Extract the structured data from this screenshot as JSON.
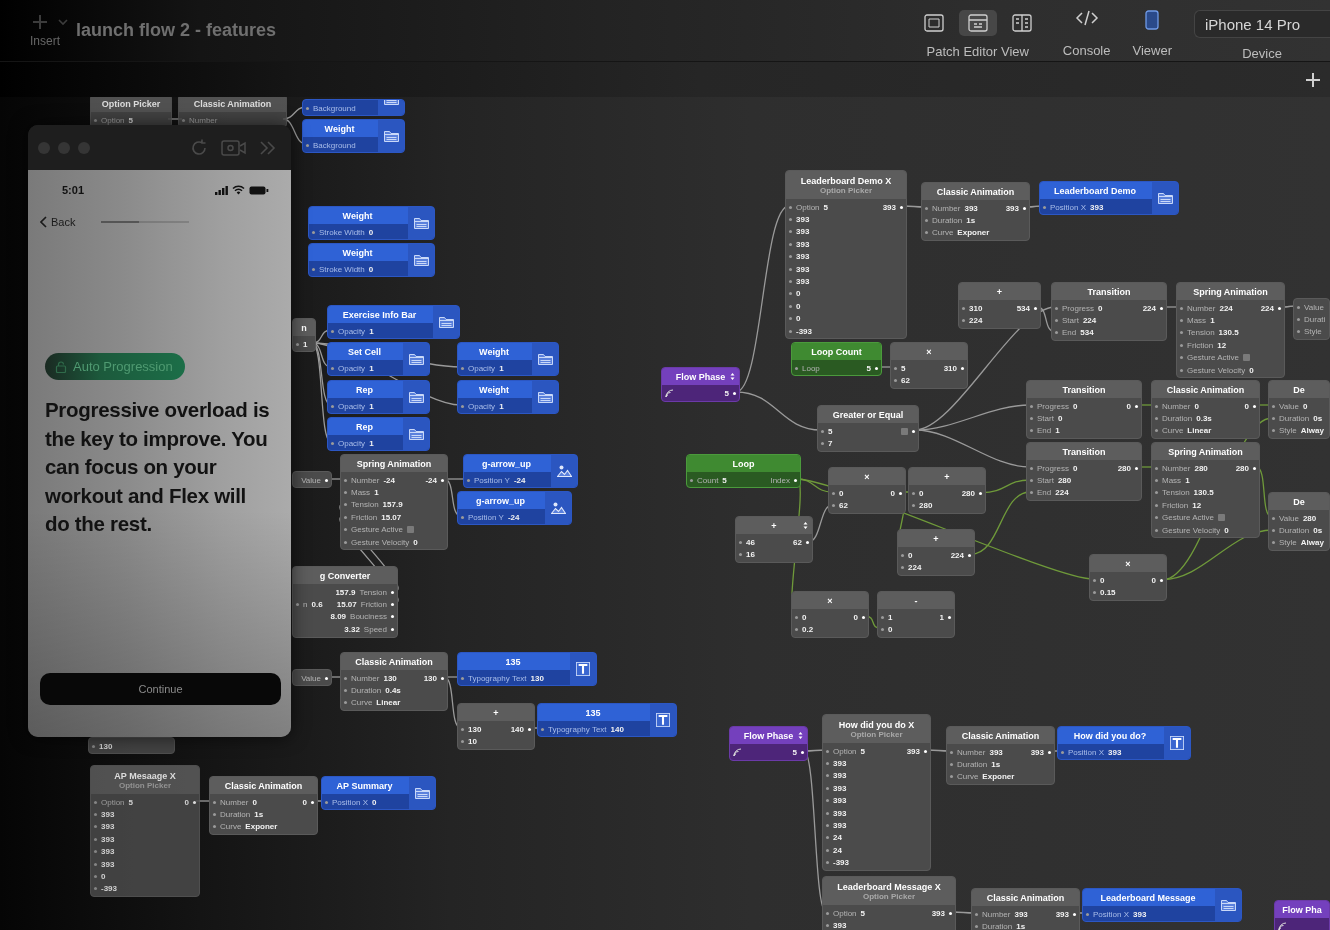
{
  "toolbar": {
    "insert_label": "Insert",
    "title": "launch flow 2 - features",
    "view_modes": [
      {
        "selected": false
      },
      {
        "selected": true
      },
      {
        "selected": false
      }
    ],
    "view_label": "Patch Editor View",
    "console_label": "Console",
    "viewer_label": "Viewer",
    "device": "iPhone 14 Pro",
    "device_label": "Device"
  },
  "preview": {
    "time": "5:01",
    "back": "Back",
    "progress": {
      "level": 0.43
    },
    "badge": "Auto Progression",
    "message": "Progressive overload is the key to improve. You can focus on your workout and Flex will do the rest.",
    "button": "Continue"
  },
  "nodes": [
    {
      "kind": "patch",
      "title": "Option Picker",
      "rows": [
        {
          "label": "Option",
          "value": "5"
        }
      ]
    },
    {
      "kind": "patch",
      "title": "Classic Animation",
      "rows": [
        {
          "label": "Number"
        }
      ]
    },
    {
      "kind": "layer_group",
      "rows": [
        {
          "label": "Background"
        }
      ]
    },
    {
      "kind": "layer_group",
      "title": "Weight",
      "rows": [
        {
          "label": "Background"
        }
      ]
    },
    {
      "kind": "layer_group",
      "title": "Weight",
      "rows": [
        {
          "label": "Stroke Width",
          "value": "0"
        }
      ]
    },
    {
      "kind": "layer_group",
      "title": "Weight",
      "rows": [
        {
          "label": "Stroke Width",
          "value": "0"
        }
      ]
    },
    {
      "kind": "patch",
      "title": "n",
      "rows": [
        {
          "value": "1"
        }
      ]
    },
    {
      "kind": "layer_group",
      "title": "Exercise Info Bar",
      "rows": [
        {
          "label": "Opacity",
          "value": "1"
        }
      ]
    },
    {
      "kind": "layer_group",
      "title": "Set Cell",
      "rows": [
        {
          "label": "Opacity",
          "value": "1"
        }
      ]
    },
    {
      "kind": "layer_group",
      "title": "Weight",
      "rows": [
        {
          "label": "Opacity",
          "value": "1"
        }
      ]
    },
    {
      "kind": "layer_group",
      "title": "Rep",
      "rows": [
        {
          "label": "Opacity",
          "value": "1"
        }
      ]
    },
    {
      "kind": "layer_group",
      "title": "Weight",
      "rows": [
        {
          "label": "Opacity",
          "value": "1"
        }
      ]
    },
    {
      "kind": "layer_group",
      "title": "Rep",
      "rows": [
        {
          "label": "Opacity",
          "value": "1"
        }
      ]
    },
    {
      "kind": "patch",
      "rows": [
        {
          "out_label": "Value"
        }
      ]
    },
    {
      "kind": "patch",
      "title": "Spring Animation",
      "rows": [
        {
          "label": "Number",
          "value": "-24",
          "out": "-24"
        },
        {
          "label": "Mass",
          "value": "1"
        },
        {
          "label": "Tension",
          "value": "157.9"
        },
        {
          "label": "Friction",
          "value": "15.07"
        },
        {
          "label": "Gesture Active",
          "checked": false
        },
        {
          "label": "Gesture Velocity",
          "value": "0"
        }
      ]
    },
    {
      "kind": "layer_image",
      "title": "g-arrow_up",
      "rows": [
        {
          "label": "Position Y",
          "value": "-24"
        }
      ]
    },
    {
      "kind": "layer_image",
      "title": "g-arrow_up",
      "rows": [
        {
          "label": "Position Y",
          "value": "-24"
        }
      ]
    },
    {
      "kind": "patch",
      "title": "g Converter",
      "rows": [
        {
          "out": "157.9",
          "out_label": "Tension"
        },
        {
          "label": "n",
          "value": "0.6",
          "out": "15.07",
          "out_label": "Friction"
        },
        {
          "out": "8.09",
          "out_label": "Bouciness"
        },
        {
          "out": "3.32",
          "out_label": "Speed"
        }
      ]
    },
    {
      "kind": "patch",
      "rows": [
        {
          "out_label": "Value"
        }
      ]
    },
    {
      "kind": "patch",
      "title": "Classic Animation",
      "rows": [
        {
          "label": "Number",
          "value": "130",
          "out": "130"
        },
        {
          "label": "Duration",
          "value": "0.4s"
        },
        {
          "label": "Curve",
          "value": "Linear"
        }
      ]
    },
    {
      "kind": "layer_text",
      "title": "135",
      "rows": [
        {
          "label": "Typography Text",
          "value": "130"
        }
      ]
    },
    {
      "kind": "patch",
      "title": "+",
      "rows": [
        {
          "value": "130",
          "out": "140"
        },
        {
          "value": "10"
        }
      ]
    },
    {
      "kind": "layer_text",
      "title": "135",
      "rows": [
        {
          "label": "Typography Text",
          "value": "140"
        }
      ]
    },
    {
      "kind": "patch",
      "rows": [
        {
          "value": "130"
        }
      ]
    },
    {
      "kind": "patch",
      "title": "AP Mesaage X",
      "subtitle": "Option Picker",
      "rows": [
        {
          "label": "Option",
          "value": "5",
          "out": "0"
        },
        {
          "value": "393"
        },
        {
          "value": "393"
        },
        {
          "value": "393"
        },
        {
          "value": "393"
        },
        {
          "value": "393"
        },
        {
          "value": "0"
        },
        {
          "value": "-393"
        }
      ]
    },
    {
      "kind": "patch",
      "title": "Classic Animation",
      "rows": [
        {
          "label": "Number",
          "value": "0",
          "out": "0"
        },
        {
          "label": "Duration",
          "value": "1s"
        },
        {
          "label": "Curve",
          "value": "Exponer"
        }
      ]
    },
    {
      "kind": "layer_group",
      "title": "AP Summary",
      "rows": [
        {
          "label": "Position X",
          "value": "0"
        }
      ]
    },
    {
      "kind": "phase",
      "title": "Flow Phase",
      "stepper": true,
      "value": "5"
    },
    {
      "kind": "patch",
      "title": "Leaderboard Demo X",
      "subtitle": "Option Picker",
      "rows": [
        {
          "label": "Option",
          "value": "5",
          "out": "393"
        },
        {
          "value": "393"
        },
        {
          "value": "393"
        },
        {
          "value": "393"
        },
        {
          "value": "393"
        },
        {
          "value": "393"
        },
        {
          "value": "393"
        },
        {
          "value": "0"
        },
        {
          "value": "0"
        },
        {
          "value": "0"
        },
        {
          "value": "-393"
        }
      ]
    },
    {
      "kind": "patch",
      "title": "Classic Animation",
      "rows": [
        {
          "label": "Number",
          "value": "393",
          "out": "393"
        },
        {
          "label": "Duration",
          "value": "1s"
        },
        {
          "label": "Curve",
          "value": "Exponer"
        }
      ]
    },
    {
      "kind": "layer_group",
      "title": "Leaderboard Demo",
      "rows": [
        {
          "label": "Position X",
          "value": "393"
        }
      ]
    },
    {
      "kind": "loop",
      "title": "Loop Count",
      "rows": [
        {
          "label": "Loop",
          "out": "5"
        }
      ]
    },
    {
      "kind": "patch",
      "title": "×",
      "rows": [
        {
          "value": "5",
          "out": "310"
        },
        {
          "value": "62"
        }
      ]
    },
    {
      "kind": "patch",
      "title": "+",
      "rows": [
        {
          "value": "310",
          "out": "534"
        },
        {
          "value": "224"
        }
      ]
    },
    {
      "kind": "patch",
      "title": "Transition",
      "rows": [
        {
          "label": "Progress",
          "value": "0",
          "out": "224"
        },
        {
          "label": "Start",
          "value": "224"
        },
        {
          "label": "End",
          "value": "534"
        }
      ]
    },
    {
      "kind": "patch",
      "title": "Spring Animation",
      "rows": [
        {
          "label": "Number",
          "value": "224",
          "out": "224"
        },
        {
          "label": "Mass",
          "value": "1"
        },
        {
          "label": "Tension",
          "value": "130.5"
        },
        {
          "label": "Friction",
          "value": "12"
        },
        {
          "label": "Gesture Active",
          "checked": false
        },
        {
          "label": "Gesture Velocity",
          "value": "0"
        }
      ]
    },
    {
      "kind": "patch",
      "rows": [
        {
          "label": "Value"
        },
        {
          "label": "Durati"
        },
        {
          "label": "Style"
        }
      ]
    },
    {
      "kind": "patch",
      "title": "Greater or Equal",
      "rows": [
        {
          "value": "5",
          "out_checked": false
        },
        {
          "value": "7"
        }
      ]
    },
    {
      "kind": "patch",
      "title": "Transition",
      "rows": [
        {
          "label": "Progress",
          "value": "0",
          "out": "0"
        },
        {
          "label": "Start",
          "value": "0"
        },
        {
          "label": "End",
          "value": "1"
        }
      ]
    },
    {
      "kind": "patch",
      "title": "Classic Animation",
      "rows": [
        {
          "label": "Number",
          "value": "0",
          "out": "0"
        },
        {
          "label": "Duration",
          "value": "0.3s"
        },
        {
          "label": "Curve",
          "value": "Linear"
        }
      ]
    },
    {
      "kind": "patch",
      "title": "De",
      "rows": [
        {
          "label": "Value",
          "value": "0"
        },
        {
          "label": "Duration",
          "value": "0s"
        },
        {
          "label": "Style",
          "value": "Alway"
        }
      ]
    },
    {
      "kind": "loop",
      "title": "Loop",
      "rows": [
        {
          "label": "Count",
          "value": "5",
          "out_label": "Index"
        }
      ]
    },
    {
      "kind": "patch",
      "title": "×",
      "rows": [
        {
          "value": "0",
          "out": "0"
        },
        {
          "value": "62"
        }
      ]
    },
    {
      "kind": "patch",
      "title": "+",
      "rows": [
        {
          "value": "0",
          "out": "280"
        },
        {
          "value": "280"
        }
      ]
    },
    {
      "kind": "patch",
      "title": "Transition",
      "rows": [
        {
          "label": "Progress",
          "value": "0",
          "out": "280"
        },
        {
          "label": "Start",
          "value": "280"
        },
        {
          "label": "End",
          "value": "224"
        }
      ]
    },
    {
      "kind": "patch",
      "title": "Spring Animation",
      "rows": [
        {
          "label": "Number",
          "value": "280",
          "out": "280"
        },
        {
          "label": "Mass",
          "value": "1"
        },
        {
          "label": "Tension",
          "value": "130.5"
        },
        {
          "label": "Friction",
          "value": "12"
        },
        {
          "label": "Gesture Active",
          "checked": false
        },
        {
          "label": "Gesture Velocity",
          "value": "0"
        }
      ]
    },
    {
      "kind": "patch",
      "title": "De",
      "rows": [
        {
          "label": "Value",
          "value": "280"
        },
        {
          "label": "Duration",
          "value": "0s"
        },
        {
          "label": "Style",
          "value": "Alway"
        }
      ]
    },
    {
      "kind": "patch",
      "title": "+",
      "stepper": true,
      "rows": [
        {
          "value": "46",
          "out": "62"
        },
        {
          "value": "16"
        }
      ]
    },
    {
      "kind": "patch",
      "title": "+",
      "rows": [
        {
          "value": "0",
          "out": "224"
        },
        {
          "value": "224"
        }
      ]
    },
    {
      "kind": "patch",
      "title": "×",
      "rows": [
        {
          "value": "0",
          "out": "0"
        },
        {
          "value": "0.15"
        }
      ]
    },
    {
      "kind": "patch",
      "title": "×",
      "rows": [
        {
          "value": "0",
          "out": "0"
        },
        {
          "value": "0.2"
        }
      ]
    },
    {
      "kind": "patch",
      "title": "-",
      "rows": [
        {
          "value": "1",
          "out": "1"
        },
        {
          "value": "0"
        }
      ]
    },
    {
      "kind": "phase",
      "title": "Flow Phase",
      "stepper": true,
      "value": "5"
    },
    {
      "kind": "patch",
      "title": "How did you do X",
      "subtitle": "Option Picker",
      "rows": [
        {
          "label": "Option",
          "value": "5",
          "out": "393"
        },
        {
          "value": "393"
        },
        {
          "value": "393"
        },
        {
          "value": "393"
        },
        {
          "value": "393"
        },
        {
          "value": "393"
        },
        {
          "value": "393"
        },
        {
          "value": "24"
        },
        {
          "value": "24"
        },
        {
          "value": "-393"
        }
      ]
    },
    {
      "kind": "patch",
      "title": "Classic Animation",
      "rows": [
        {
          "label": "Number",
          "value": "393",
          "out": "393"
        },
        {
          "label": "Duration",
          "value": "1s"
        },
        {
          "label": "Curve",
          "value": "Exponer"
        }
      ]
    },
    {
      "kind": "layer_text",
      "title": "How did you do?",
      "rows": [
        {
          "label": "Position X",
          "value": "393"
        }
      ]
    },
    {
      "kind": "patch",
      "title": "Leaderboard Message X",
      "subtitle": "Option Picker",
      "rows": [
        {
          "label": "Option",
          "value": "5",
          "out": "393"
        },
        {
          "value": "393"
        }
      ]
    },
    {
      "kind": "patch",
      "title": "Classic Animation",
      "rows": [
        {
          "label": "Number",
          "value": "393",
          "out": "393"
        },
        {
          "label": "Duration",
          "value": "1s"
        }
      ]
    },
    {
      "kind": "layer_group",
      "title": "Leaderboard Message",
      "rows": [
        {
          "label": "Position X",
          "value": "393"
        }
      ]
    },
    {
      "kind": "phase",
      "title": "Flow Pha",
      "stepper": false
    }
  ]
}
